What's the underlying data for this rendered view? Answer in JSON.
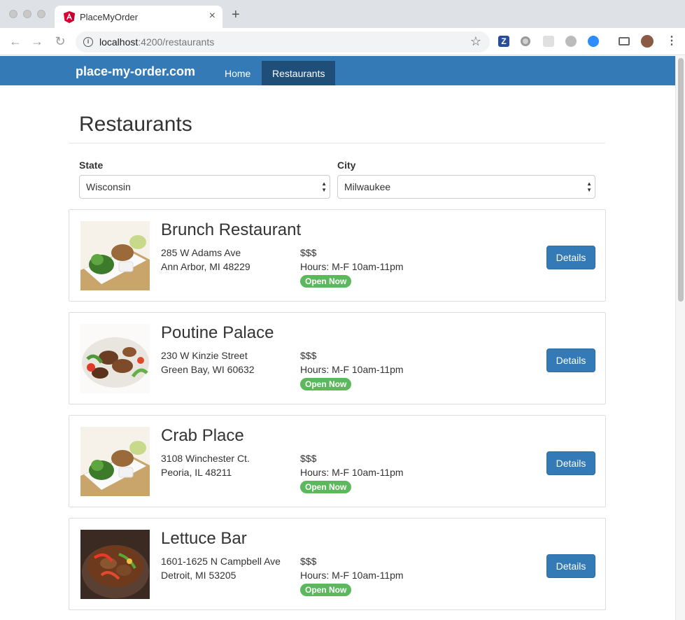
{
  "browser": {
    "tab_title": "PlaceMyOrder",
    "tab_close": "×",
    "new_tab": "+",
    "url_host": "localhost",
    "url_port_path": ":4200/restaurants"
  },
  "navbar": {
    "brand": "place-my-order.com",
    "links": [
      {
        "label": "Home",
        "active": false
      },
      {
        "label": "Restaurants",
        "active": true
      }
    ],
    "color": "#337ab7",
    "active_color": "#1f4e79"
  },
  "page": {
    "title": "Restaurants"
  },
  "filters": {
    "state": {
      "label": "State",
      "value": "Wisconsin"
    },
    "city": {
      "label": "City",
      "value": "Milwaukee"
    }
  },
  "restaurants": [
    {
      "name": "Brunch Restaurant",
      "address1": "285 W Adams Ave",
      "address2": "Ann Arbor, MI 48229",
      "price": "$$$",
      "hours": "Hours: M-F 10am-11pm",
      "status": "Open Now",
      "button": "Details",
      "image": "sushi-plate"
    },
    {
      "name": "Poutine Palace",
      "address1": "230 W Kinzie Street",
      "address2": "Green Bay, WI 60632",
      "price": "$$$",
      "hours": "Hours: M-F 10am-11pm",
      "status": "Open Now",
      "button": "Details",
      "image": "beef-salad"
    },
    {
      "name": "Crab Place",
      "address1": "3108 Winchester Ct.",
      "address2": "Peoria, IL 48211",
      "price": "$$$",
      "hours": "Hours: M-F 10am-11pm",
      "status": "Open Now",
      "button": "Details",
      "image": "sushi-plate"
    },
    {
      "name": "Lettuce Bar",
      "address1": "1601-1625 N Campbell Ave",
      "address2": "Detroit, MI 53205",
      "price": "$$$",
      "hours": "Hours: M-F 10am-11pm",
      "status": "Open Now",
      "button": "Details",
      "image": "stew-pot"
    }
  ],
  "colors": {
    "primary": "#337ab7",
    "success": "#5cb85c"
  }
}
